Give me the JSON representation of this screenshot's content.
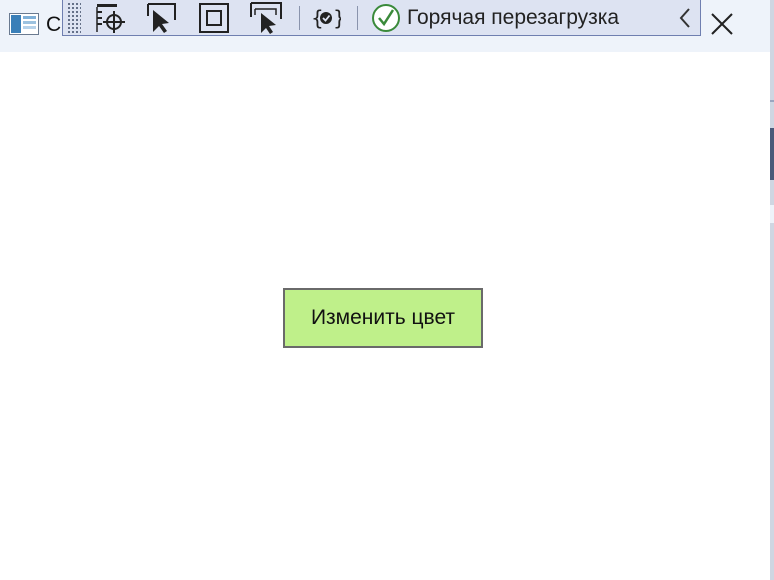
{
  "window": {
    "title": "C",
    "close_label": "Close"
  },
  "toolbar": {
    "buttons": [
      {
        "icon": "go-to-live-visual-tree-icon"
      },
      {
        "icon": "select-element-icon"
      },
      {
        "icon": "display-layout-adorners-icon"
      },
      {
        "icon": "track-focused-element-icon"
      },
      {
        "icon": "binding-failures-icon"
      }
    ],
    "hot_reload_label": "Горячая перезагрузка",
    "hot_reload_status": "ok",
    "collapse_icon": "chevron-left-icon"
  },
  "main": {
    "button_label": "Изменить цвет",
    "button_color": "#bff08a"
  }
}
